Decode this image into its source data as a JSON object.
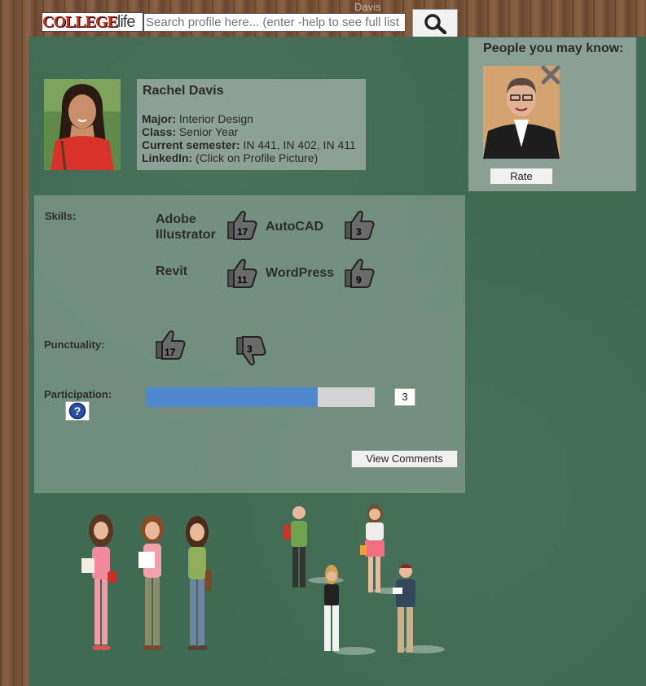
{
  "header": {
    "logo_part1": "COLLEGE",
    "logo_part2": "life",
    "search_placeholder": "Search profile here... (enter -help to see full list of commands)",
    "ghost_text": "Davis Student"
  },
  "profile": {
    "name": "Rachel Davis",
    "major_label": "Major:",
    "major": "Interior Design",
    "class_label": "Class:",
    "class": "Senior Year",
    "semester_label": "Current semester:",
    "semester": "IN 441, IN 402, IN 411",
    "linkedin_label": "LinkedIn:",
    "linkedin": "(Click on Profile Picture)"
  },
  "people_you_may_know": {
    "title": "People you may know:",
    "rate_label": "Rate"
  },
  "skills": {
    "label": "Skills:",
    "items": [
      {
        "name": "Adobe Illustrator",
        "count": "17"
      },
      {
        "name": "AutoCAD",
        "count": "3"
      },
      {
        "name": "Revit",
        "count": "11"
      },
      {
        "name": "WordPress",
        "count": "9"
      }
    ]
  },
  "punctuality": {
    "label": "Punctuality:",
    "up": "17",
    "down": "3"
  },
  "participation": {
    "label": "Participation:",
    "level": 0.75,
    "count": "3"
  },
  "comments_label": "View Comments",
  "colors": {
    "board": "#3f6a53",
    "progress_fill": "#4f88cf",
    "logo_red": "#c62f1f"
  }
}
